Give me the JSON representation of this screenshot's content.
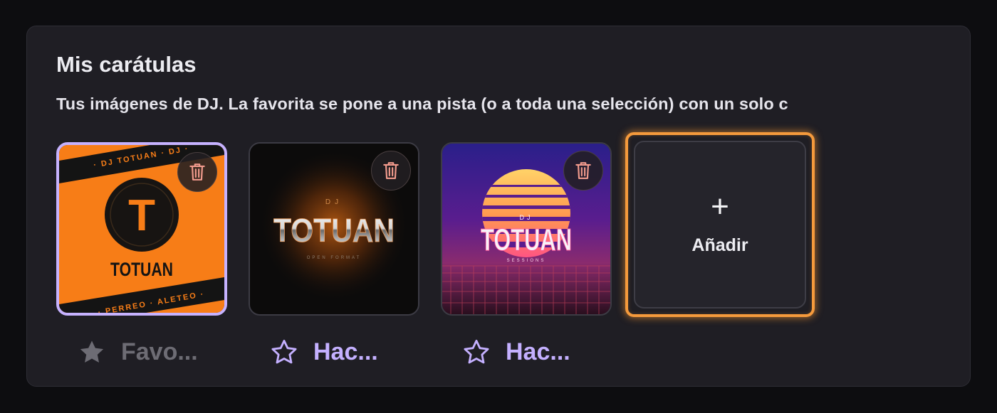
{
  "section": {
    "title": "Mis carátulas",
    "subtitle": "Tus imágenes de DJ. La favorita se pone a una pista (o a toda una selección) con un solo c"
  },
  "covers": [
    {
      "art_id": "orange-totuan",
      "favorite": true,
      "favorite_label": "Favo...",
      "art_text": {
        "monogram": "T",
        "name": "TOTUAN",
        "band_top": "· DJ TOTUAN · DJ ·",
        "band_bottom": "· PERREO · ALETEO ·"
      }
    },
    {
      "art_id": "chrome-totuan",
      "favorite": false,
      "favorite_label": "Hac...",
      "art_text": {
        "prefix": "DJ",
        "name": "TOTUAN",
        "tagline": "OPEN FORMAT"
      }
    },
    {
      "art_id": "synthwave-totuan",
      "favorite": false,
      "favorite_label": "Hac...",
      "art_text": {
        "prefix": "DJ",
        "name": "TOTUAN",
        "tagline": "SESSIONS"
      }
    }
  ],
  "add_button": {
    "label": "Añadir",
    "icon": "plus-icon"
  },
  "icons": {
    "delete": "trash-icon",
    "favorite_on": "star-filled-icon",
    "favorite_off": "star-outline-icon"
  },
  "colors": {
    "panel_bg": "#1f1e24",
    "accent_purple": "#c4b0ff",
    "accent_orange": "#f59a3c",
    "muted_text": "#6d6c74",
    "trash_icon": "#f29b8d"
  }
}
